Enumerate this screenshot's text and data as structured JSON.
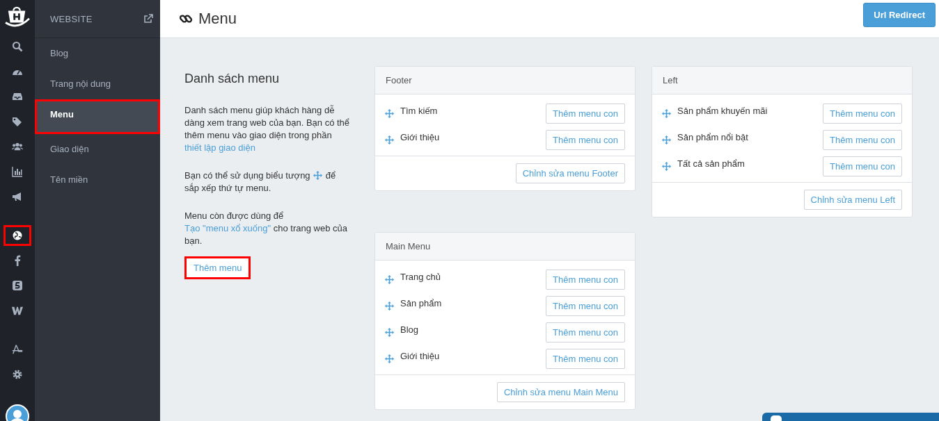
{
  "rail": [
    {
      "kind": "search",
      "selected": false
    },
    {
      "kind": "dashboard",
      "selected": false
    },
    {
      "kind": "inbox",
      "selected": false
    },
    {
      "kind": "tags",
      "selected": false
    },
    {
      "kind": "users",
      "selected": false
    },
    {
      "kind": "chart",
      "selected": false
    },
    {
      "kind": "megaphone",
      "selected": false
    },
    {
      "kind": "globe",
      "selected": true
    },
    {
      "kind": "facebook",
      "selected": false
    },
    {
      "kind": "five",
      "selected": false
    },
    {
      "kind": "w",
      "selected": false
    },
    {
      "kind": "apps",
      "selected": false
    },
    {
      "kind": "gear",
      "selected": false
    }
  ],
  "sidebar": {
    "title": "WEBSITE",
    "items": [
      {
        "label": "Blog",
        "selected": false
      },
      {
        "label": "Trang nội dung",
        "selected": false
      },
      {
        "label": "Menu",
        "selected": true
      },
      {
        "label": "Giao diện",
        "selected": false
      },
      {
        "label": "Tên miền",
        "selected": false
      }
    ]
  },
  "header": {
    "title": "Menu",
    "button": "Url Redirect"
  },
  "intro": {
    "heading": "Danh sách menu",
    "paragraphs": [
      [
        {
          "kind": "text",
          "text": "Danh sách menu giúp khách hàng dễ dàng xem trang web của bạn. Bạn có thể thêm menu vào giao diện trong phần "
        },
        {
          "kind": "link",
          "text": "thiết lập giao diện"
        }
      ],
      [
        {
          "kind": "text",
          "text": "Bạn có thể sử dụng biểu tượng "
        },
        {
          "kind": "icon"
        },
        {
          "kind": "text",
          "text": " để sắp xếp thứ tự menu."
        }
      ],
      [
        {
          "kind": "text",
          "text": "Menu còn được dùng để"
        },
        {
          "kind": "break"
        },
        {
          "kind": "link",
          "text": "Tạo \"menu xổ xuống\""
        },
        {
          "kind": "text",
          "text": " cho trang web của bạn."
        }
      ]
    ],
    "button": "Thêm menu"
  },
  "menu_columns": [
    [
      {
        "title": "Footer",
        "items": [
          {
            "label": "Tìm kiếm",
            "button": "Thêm menu con"
          },
          {
            "label": "Giới thiệu",
            "button": "Thêm menu con"
          }
        ],
        "edit_button": "Chỉnh sửa menu Footer"
      },
      {
        "title": "Main Menu",
        "items": [
          {
            "label": "Trang chủ",
            "button": "Thêm menu con"
          },
          {
            "label": "Sản phẩm",
            "button": "Thêm menu con"
          },
          {
            "label": "Blog",
            "button": "Thêm menu con"
          },
          {
            "label": "Giới thiệu",
            "button": "Thêm menu con"
          }
        ],
        "edit_button": "Chỉnh sửa menu Main Menu"
      }
    ],
    [
      {
        "title": "Left",
        "items": [
          {
            "label": "Sản phẩm khuyến mãi",
            "button": "Thêm menu con"
          },
          {
            "label": "Sản phẩm nổi bật",
            "button": "Thêm menu con"
          },
          {
            "label": "Tất cả sản phẩm",
            "button": "Thêm menu con"
          }
        ],
        "edit_button": "Chỉnh sửa menu Left"
      }
    ]
  ]
}
